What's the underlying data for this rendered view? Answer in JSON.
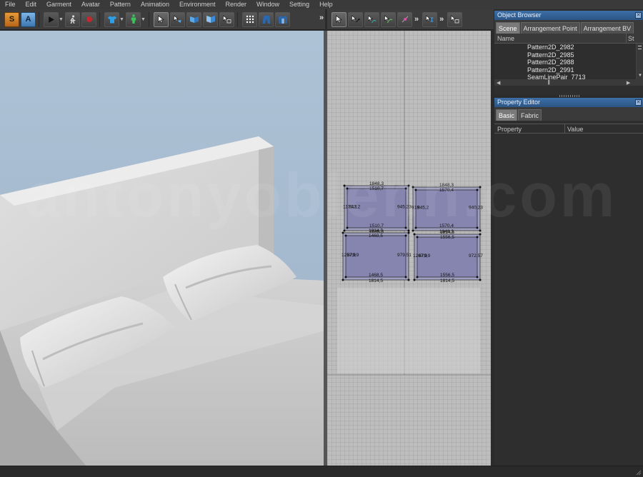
{
  "menu": [
    "File",
    "Edit",
    "Garment",
    "Avatar",
    "Pattern",
    "Animation",
    "Environment",
    "Render",
    "Window",
    "Setting",
    "Help"
  ],
  "toolbar_left": {
    "s_label": "S",
    "a_label": "A",
    "more": "»"
  },
  "toolbar_mid": {
    "more1": "»",
    "more2": "»"
  },
  "object_browser": {
    "title": "Object Browser",
    "tabs": [
      "Scene",
      "Arrangement Point",
      "Arrangement BV"
    ],
    "columns": {
      "name": "Name",
      "status": "St"
    },
    "rows": [
      "Pattern2D_2982",
      "Pattern2D_2985",
      "Pattern2D_2988",
      "Pattern2D_2991",
      "SeamLinePair_7713"
    ]
  },
  "property_editor": {
    "title": "Property Editor",
    "tabs": [
      "Basic",
      "Fabric"
    ],
    "columns": {
      "property": "Property",
      "value": "Value"
    }
  },
  "watermark": "antonyoblenn.com",
  "patterns": [
    {
      "top": "1848,3",
      "inner_top": "1510,7",
      "left": "1173,2",
      "inner_left": "843,2",
      "right": "945,23",
      "bottom": "1510,7",
      "outer_bottom": "1848,3"
    },
    {
      "top": "1848,3",
      "inner_top": "1570,4",
      "left": "918",
      "inner_left": "945,2",
      "right": "940,23",
      "bottom": "1570,4",
      "outer_bottom": "1848,3"
    },
    {
      "top": "1814,5",
      "inner_top": "1468,5",
      "left": "1257,9",
      "inner_left": "879,9",
      "right": "979,51",
      "bottom": "1468,5",
      "outer_bottom": "1814,5"
    },
    {
      "top": "1814,5",
      "inner_top": "1556,5",
      "left": "1267,9",
      "inner_left": "879,9",
      "right": "972,57",
      "bottom": "1556,5",
      "outer_bottom": "1814,5"
    }
  ]
}
